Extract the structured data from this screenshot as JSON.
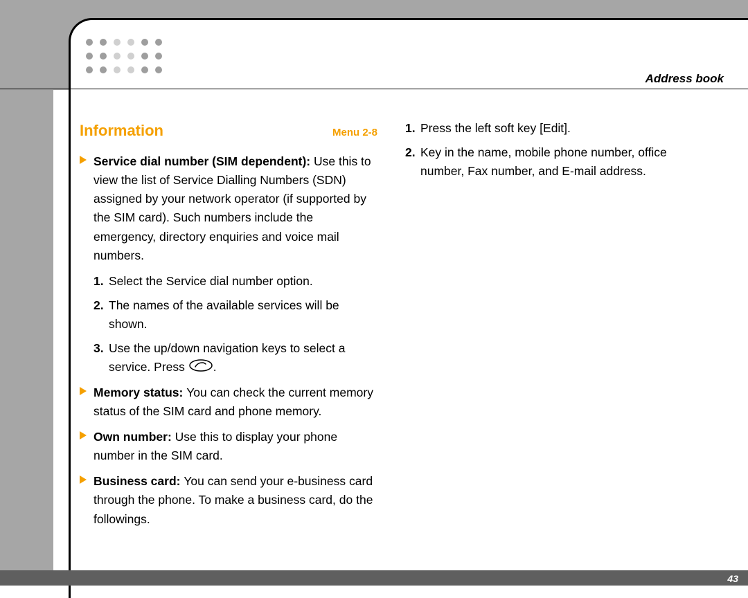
{
  "header": {
    "section_label": "Address book"
  },
  "left": {
    "title": "Information",
    "menu": "Menu 2-8",
    "items": [
      {
        "lead": "Service dial number (SIM dependent): ",
        "body": "Use this to view the list of Service Dialling Numbers (SDN) assigned by your network operator (if supported by the SIM card). Such numbers include the emergency, directory enquiries and voice mail numbers."
      },
      {
        "lead": "Memory status: ",
        "body": "You can check the current memory status of the SIM card and phone memory."
      },
      {
        "lead": "Own number: ",
        "body": "Use this to display your phone number in the SIM card."
      },
      {
        "lead": "Business card: ",
        "body": "You can send your e-business card through the phone. To make a business card, do the followings."
      }
    ],
    "sdn_steps": [
      "Select the Service dial number option.",
      "The names of the available services will be shown.",
      "Use the up/down navigation keys to select a service. Press "
    ],
    "sdn_step3_tail": "."
  },
  "right": {
    "steps": [
      "Press the left soft key [Edit].",
      "Key in the name, mobile phone number, office number, Fax number, and E-mail address."
    ]
  },
  "page_number": "43"
}
